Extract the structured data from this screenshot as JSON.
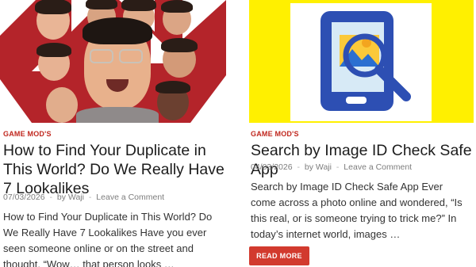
{
  "posts": [
    {
      "category": "GAME MOD'S",
      "title": "How to Find Your Duplicate in This World? Do We Really Have 7 Lookalikes",
      "date": "07/03/2026",
      "by": "by",
      "author": "Waji",
      "comment_link": "Leave a Comment",
      "excerpt": "How to Find Your Duplicate in This World? Do We Really Have 7 Lookalikes Have you ever seen someone online or on the street and thought, “Wow… that person looks …"
    },
    {
      "category": "GAME MOD'S",
      "title": "Search by Image ID Check Safe App",
      "date": "04/03/2026",
      "by": "by",
      "author": "Waji",
      "comment_link": "Leave a Comment",
      "excerpt": "Search by Image ID Check Safe App Ever come across a photo online and wondered, “Is this real, or is someone trying to trick me?” In today’s internet world, images …",
      "read_more": "READ MORE"
    }
  ],
  "meta_separator": "-",
  "colors": {
    "accent": "#c0271e",
    "button": "#d23a2e",
    "thumb_yellow": "#fff000",
    "icon_blue": "#2d4fb3"
  },
  "icons": {
    "right_thumbnail": "image-search-tablet-icon"
  }
}
